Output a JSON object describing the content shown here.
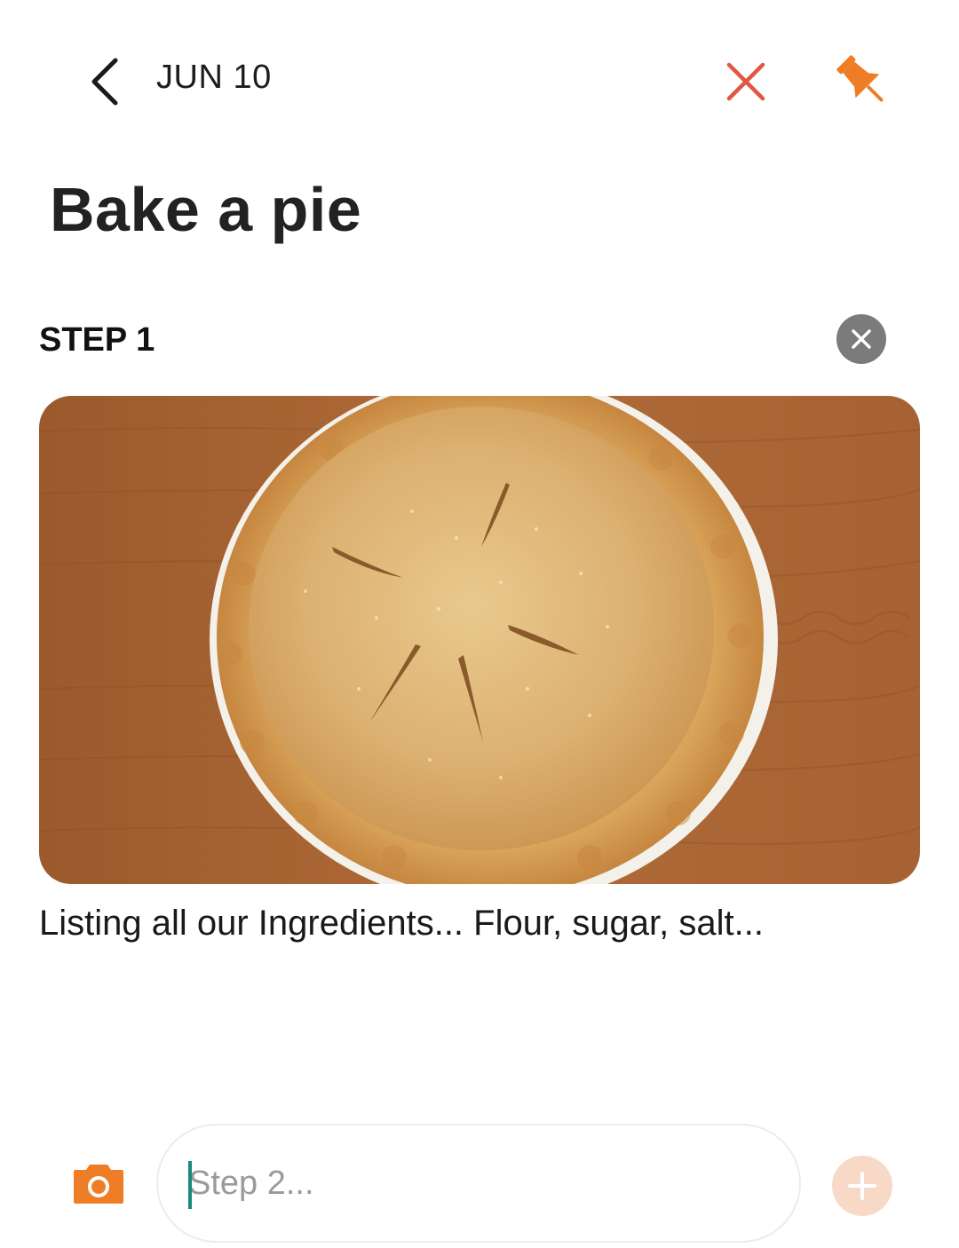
{
  "header": {
    "date": "JUN 10",
    "icons": {
      "back": "chevron-left-icon",
      "delete": "close-icon",
      "pin": "pin-icon"
    }
  },
  "note": {
    "title": "Bake a pie"
  },
  "steps": [
    {
      "label": "STEP 1",
      "image": "apple-pie-photo",
      "text": "Listing all our Ingredients... Flour, sugar, salt..."
    }
  ],
  "composer": {
    "placeholder": "Step 2...",
    "value": "",
    "icons": {
      "camera": "camera-icon",
      "add": "plus-icon"
    }
  },
  "colors": {
    "accent": "#ee7d26",
    "delete": "#e15744",
    "remove_badge": "#7b7b7b",
    "add_disabled": "#f8d9c7"
  }
}
